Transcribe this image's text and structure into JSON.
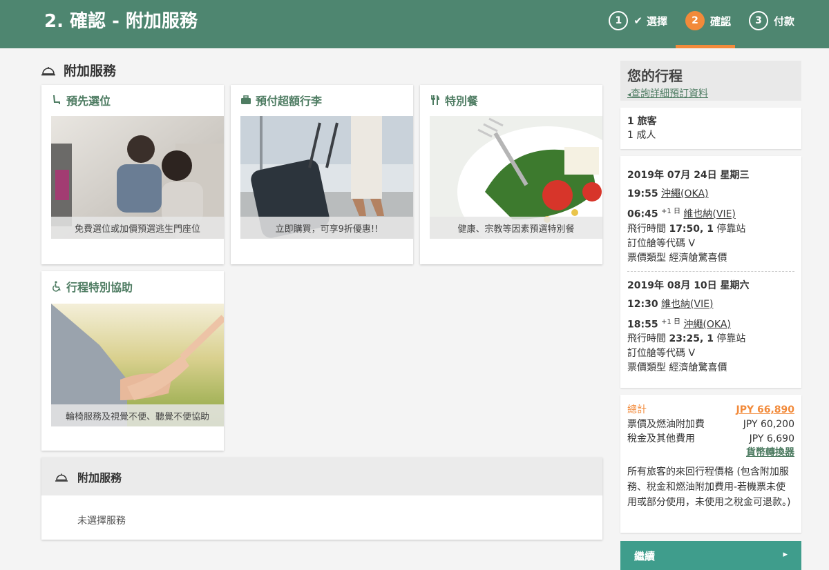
{
  "header": {
    "title": "2. 確認 - 附加服務",
    "steps": [
      {
        "num": "1",
        "label": "選擇",
        "check": "✔"
      },
      {
        "num": "2",
        "label": "確認"
      },
      {
        "num": "3",
        "label": "付款"
      }
    ]
  },
  "section_title": "附加服務",
  "cards": [
    {
      "title": "預先選位",
      "caption": "免費選位或加價預選逃生門座位",
      "icon": "seat-icon"
    },
    {
      "title": "預付超額行李",
      "caption": "立即購買，可享9折優惠!!",
      "icon": "luggage-icon"
    },
    {
      "title": "特別餐",
      "caption": "健康、宗教等因素預選特別餐",
      "icon": "utensils-icon"
    },
    {
      "title": "行程特別協助",
      "caption": "輪椅服務及視覺不便、聽覺不便協助",
      "icon": "wheelchair-icon"
    }
  ],
  "summary": {
    "title": "附加服務",
    "empty_text": "未選擇服務"
  },
  "sidebar": {
    "title": "您的行程",
    "detail_link": "查詢詳細預訂資料",
    "passengers": {
      "line1": "1 旅客",
      "line2": "1 成人"
    },
    "outbound": {
      "date": "2019年 07月 24日 星期三",
      "dep_time": "19:55",
      "dep_city": "沖繩(OKA)",
      "arr_time": "06:45",
      "arr_plus": "+1 日",
      "arr_city": "維也納(VIE)",
      "duration_label": "飛行時間",
      "duration": "17:50, 1",
      "stops_label": "停靠站",
      "booking_class": "訂位艙等代碼 V",
      "fare_type": "票價類型 經濟艙驚喜價"
    },
    "inbound": {
      "date": "2019年 08月 10日 星期六",
      "dep_time": "12:30",
      "dep_city": "維也納(VIE)",
      "arr_time": "18:55",
      "arr_plus": "+1 日",
      "arr_city": "沖繩(OKA)",
      "duration_label": "飛行時間",
      "duration": "23:25, 1",
      "stops_label": "停靠站",
      "booking_class": "訂位艙等代碼 V",
      "fare_type": "票價類型 經濟艙驚喜價"
    },
    "price": {
      "total_label": "總計",
      "total_value": "JPY 66,890",
      "fare_label": "票價及燃油附加費",
      "fare_value": "JPY 60,200",
      "tax_label": "稅金及其他費用",
      "tax_value": "JPY 6,690",
      "converter_link": "貨幣轉換器",
      "note": "所有旅客的來回行程價格 (包含附加服務、稅金和燃油附加費用-若機票未使用或部分使用，未使用之稅金可退款。)"
    },
    "continue_label": "繼續"
  },
  "colors": {
    "header": "#4e8670",
    "accent": "#f28a3a",
    "button": "#3f9d8c",
    "green_text": "#4e7c62"
  }
}
